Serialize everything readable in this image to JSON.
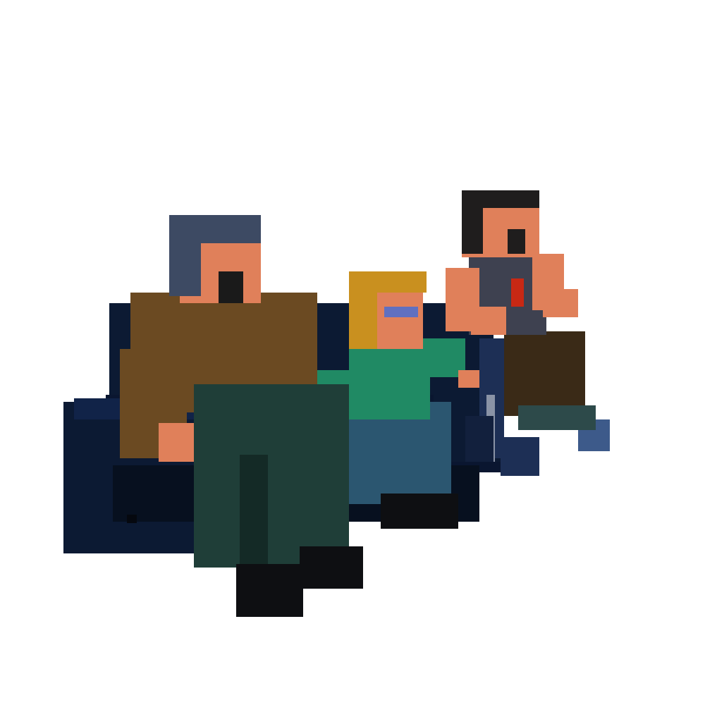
{
  "scene": {
    "background": "#ffffff",
    "subjects": [
      "sofa",
      "older-man-figure",
      "child-figure",
      "young-man-figure-wheelchair"
    ],
    "palette": {
      "sofa": "#0c1a33",
      "sofa_dark": "#07101f",
      "skin": "#e0805a",
      "skin_shadow": "#b05f40",
      "hair_gray": "#3d4a63",
      "hair_blond": "#c9901f",
      "hair_dark": "#1f1d1d",
      "jacket_brown": "#6b4a22",
      "pants_green": "#1f3e38",
      "shirt_teal": "#208a64",
      "jeans_blue": "#2b5670",
      "shirt_gray": "#3e4150",
      "shirt_logo_red": "#c82814",
      "shoes_black": "#0e0f12",
      "glasses_blue": "#6070c0",
      "wheelchair_blue": "#1d2f55",
      "wheelchair_metal": "#8a93a6"
    }
  }
}
